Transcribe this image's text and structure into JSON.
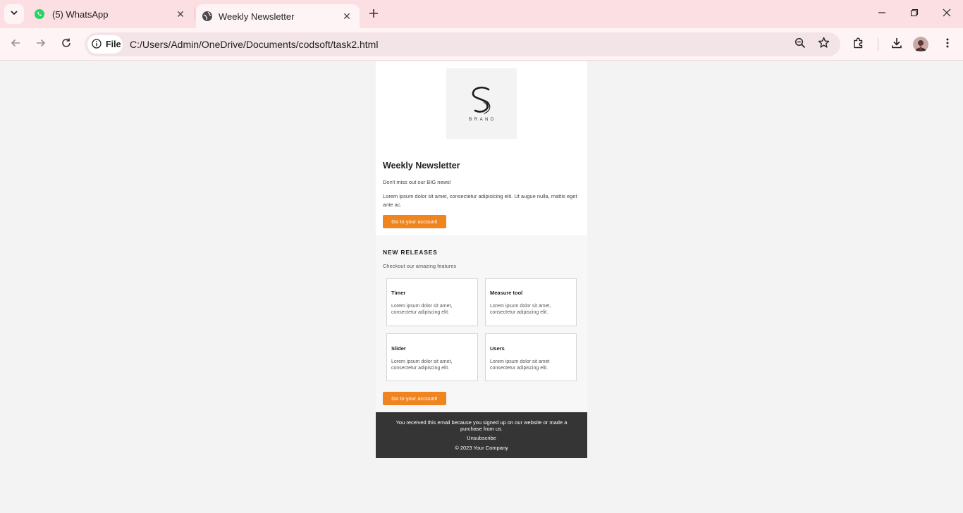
{
  "browser": {
    "tabs": [
      {
        "title": "(5) WhatsApp",
        "icon": "whatsapp-icon",
        "active": false
      },
      {
        "title": "Weekly Newsletter",
        "icon": "globe-icon",
        "active": true
      }
    ],
    "address": {
      "scheme_label": "File",
      "url": "C:/Users/Admin/OneDrive/Documents/codsoft/task2.html"
    },
    "colors": {
      "tabstrip": "#fcdfe3",
      "toolbar": "#fff4f5",
      "omnibox": "#f3e4e7"
    }
  },
  "newsletter": {
    "logo": {
      "letter": "S",
      "word": "BRAND"
    },
    "title": "Weekly Newsletter",
    "intro": "Don't miss out our BIG news!",
    "body": "Lorem ipsum dolor sit amet, consectetur adipisicing elit. Ut augue nulla, mattis eget ante ac.",
    "cta_label": "Go to your account!",
    "releases": {
      "heading": "NEW RELEASES",
      "subheading": "Checkout our amazing features",
      "features": [
        {
          "title": "Timer",
          "description": "Lorem ipsum dolor sit amet, consectetur adipiscing elit."
        },
        {
          "title": "Measure tool",
          "description": "Lorem ipsum dolor sit amet, consectetur adipiscing elit."
        },
        {
          "title": "Slider",
          "description": "Lorem ipsum dolor sit amet, consectetur adipiscing elit."
        },
        {
          "title": "Users",
          "description": "Lorem ipsum dolor sit amet consectetur adipiscing elit."
        }
      ],
      "cta_label": "Go to your account!"
    },
    "footer": {
      "notice": "You received this email because you signed up on our website or made a purchase from us.",
      "unsubscribe": "Unsubscribe",
      "copyright": "© 2023 Your Company"
    },
    "colors": {
      "accent": "#f0851f",
      "footer_bg": "#353535",
      "page_bg": "#f3f3f3"
    }
  }
}
